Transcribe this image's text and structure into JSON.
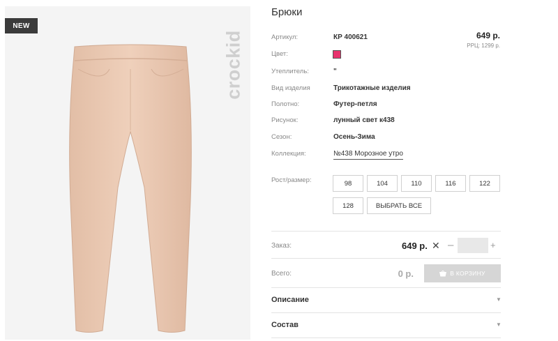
{
  "product": {
    "badge": "NEW",
    "brand": "crockid",
    "title": "Брюки",
    "price": "649 р.",
    "rrp": "РРЦ: 1299 р.",
    "color_hex": "#e8336e",
    "attributes": [
      {
        "label": "Артикул:",
        "value": "КР 400621"
      },
      {
        "label": "Цвет:",
        "value": ""
      },
      {
        "label": "Утеплитель:",
        "value": "\""
      },
      {
        "label": "Вид изделия",
        "value": "Трикотажные изделия"
      },
      {
        "label": "Полотно:",
        "value": "Футер-петля"
      },
      {
        "label": "Рисунок:",
        "value": "лунный свет к438"
      },
      {
        "label": "Сезон:",
        "value": "Осень-Зима"
      },
      {
        "label": "Коллекция:",
        "value": "№438 Морозное утро"
      }
    ]
  },
  "sizes": {
    "label": "Рост/размер:",
    "options": [
      "98",
      "104",
      "110",
      "116",
      "122",
      "128"
    ],
    "select_all": "ВЫБРАТЬ ВСЕ"
  },
  "order": {
    "label": "Заказ:",
    "price": "649 р.",
    "remove": "✕",
    "minus": "–",
    "plus": "+",
    "quantity": ""
  },
  "total": {
    "label": "Всего:",
    "value": "0 р.",
    "cart_button": "В КОРЗИНУ"
  },
  "accordion": [
    {
      "title": "Описание"
    },
    {
      "title": "Состав"
    }
  ]
}
